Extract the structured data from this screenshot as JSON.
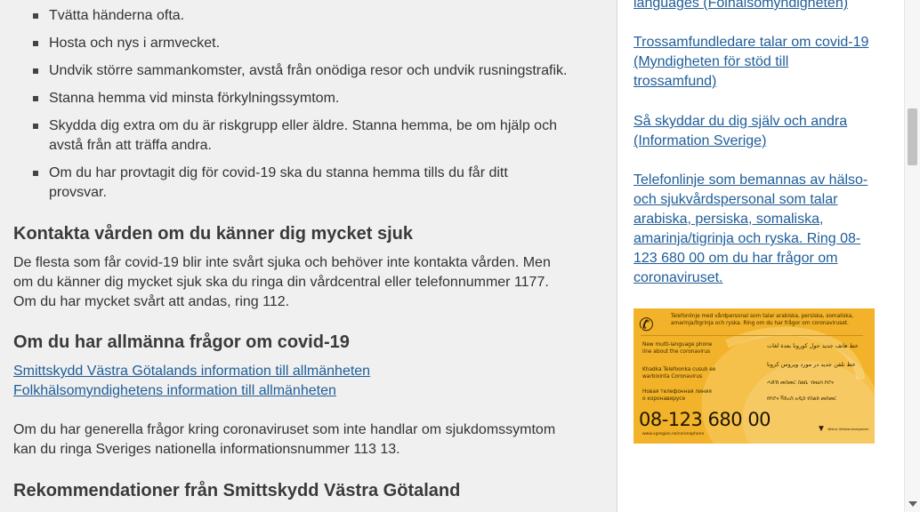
{
  "bullets": [
    "Tvätta händerna ofta.",
    "Hosta och nys i armvecket.",
    "Undvik större sammankomster, avstå från onödiga resor och undvik rusningstrafik.",
    "Stanna hemma vid minsta förkylningssymtom.",
    "Skydda dig extra om du är riskgrupp eller äldre. Stanna hemma, be om hjälp och avstå från att träffa andra.",
    "Om du har provtagit dig för covid-19 ska du stanna hemma tills du får ditt provsvar."
  ],
  "section_contact": {
    "heading": "Kontakta vården om du känner dig mycket sjuk",
    "text": "De flesta som får covid-19 blir inte svårt sjuka och behöver inte kontakta vården. Men om du känner dig mycket sjuk ska du ringa din vårdcentral eller telefonnummer 1177. Om du har mycket svårt att andas, ring 112."
  },
  "section_general": {
    "heading": "Om du har allmänna frågor om covid-19",
    "links": [
      "Smittskydd Västra Götalands information till allmänheten",
      "Folkhälsomyndighetens information till allmänheten"
    ],
    "text": "Om du har generella frågor kring coronaviruset som inte handlar om sjukdomssymtom kan du ringa Sveriges nationella informationsnummer 113 13."
  },
  "section_recommend": {
    "heading": "Rekommendationer från Smittskydd Västra Götaland"
  },
  "sidebar": {
    "links": [
      "languages (Folhälsomyndigheten)",
      "Trossamfundledare talar om covid-19 (Myndigheten för stöd till trossamfund)",
      "Så skyddar du dig själv och andra (Information Sverige)",
      "Telefonlinje som bemannas av hälso- och sjukvårdspersonal som talar arabiska, persiska, somaliska, amarinja/tigrinja och ryska. Ring 08-123 680 00 om du har frågor om coronaviruset."
    ]
  },
  "promo": {
    "headline": "Telefonlinje med vårdpersonal som talar arabiska, persiska, somaliska,",
    "headline2": "amarinja/tigrinja och ryska. Ring om du har frågor om coronaviruset.",
    "en_line1": "New multi-language phone",
    "en_line2": "line about the coronavirus",
    "so_line1": "Khadka Telefoonka cusub ee",
    "so_line2": "warbixinta Coronavirus",
    "ru_line1": "Новая телефонная линия",
    "ru_line2": "о коронавирусе",
    "ar_line1": "خط هاتف جديد حول كورونا بعدة لغات",
    "fa_line1": "خط تلفن جدید در مورد ویروس کرونا",
    "ti_line1": "ሓድሽ መስመር ስልኪ ብዛዕባ ኮሮና",
    "am_line1": "የኮሮና ቫይረስ አዲስ የስልክ መስመር",
    "phone": "08-123 680 00",
    "url": "www.vgregion.se/coronaphone",
    "org": "Västra Götalandsregionen",
    "color_bg": "#f2b229"
  }
}
